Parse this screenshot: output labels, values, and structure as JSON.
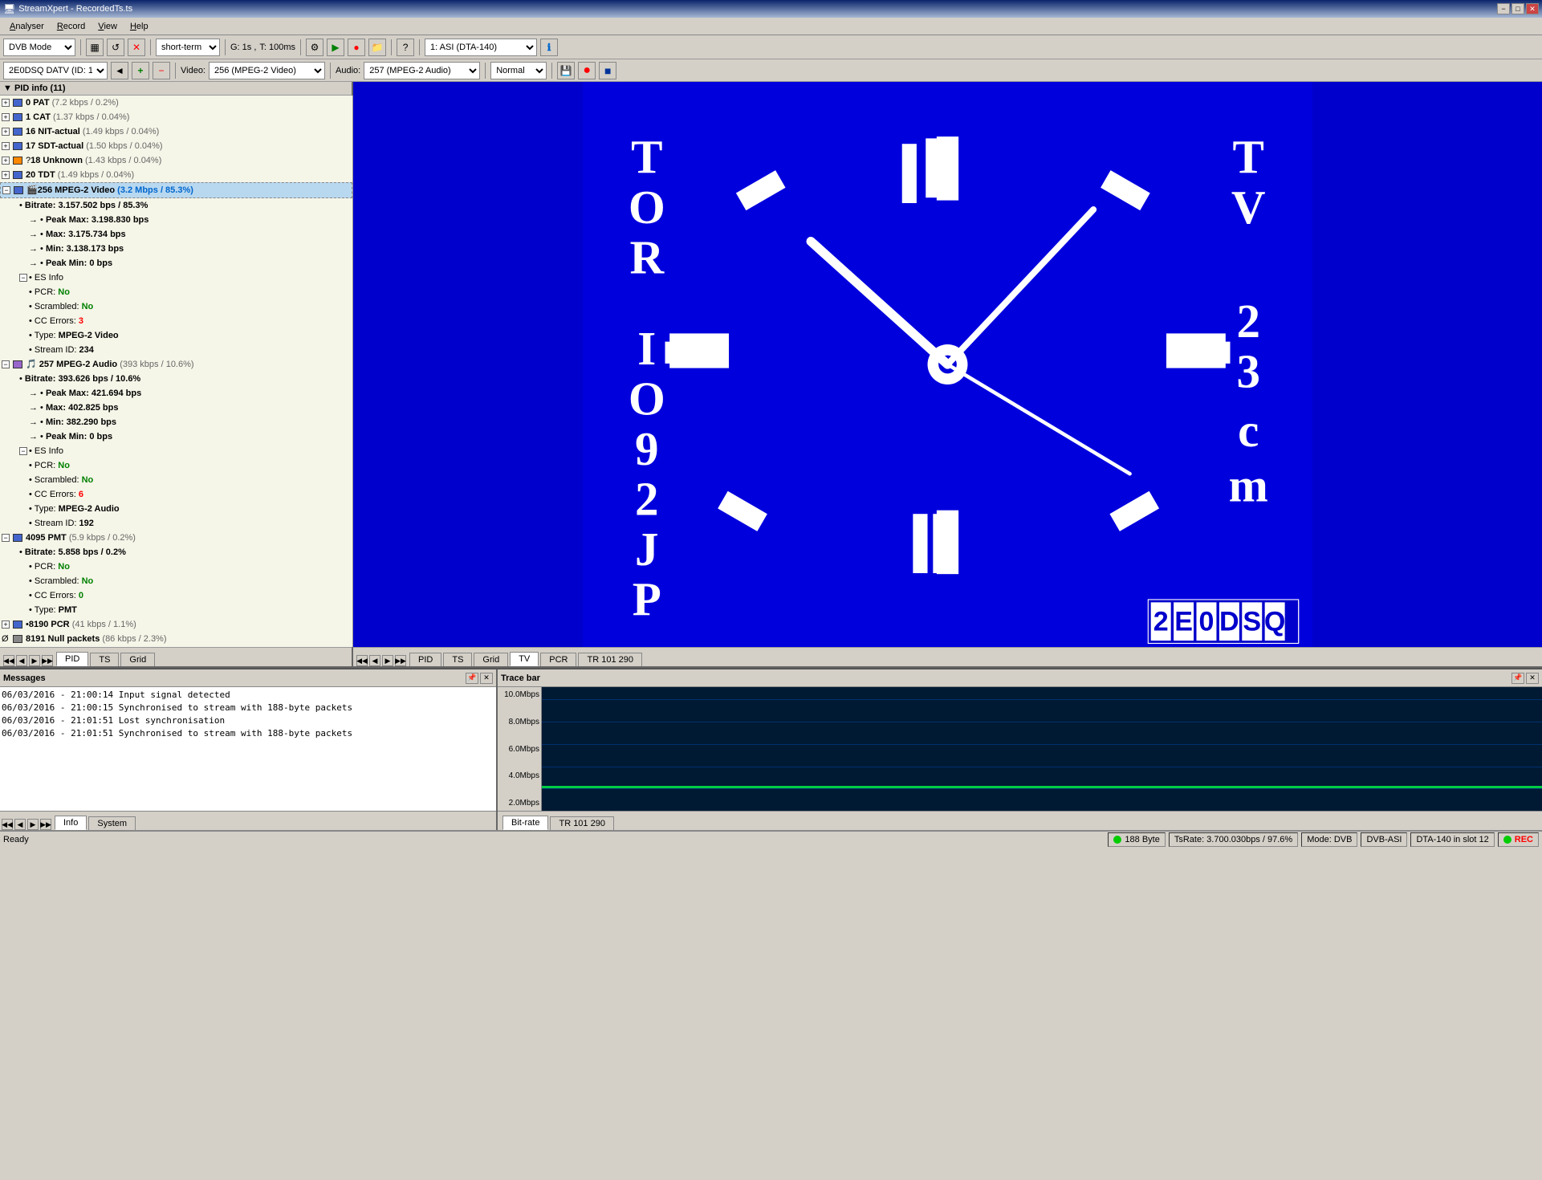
{
  "titlebar": {
    "title": "StreamXpert - RecordedTs.ts",
    "icon": "🖥️",
    "min_btn": "−",
    "max_btn": "□",
    "close_btn": "✕"
  },
  "menubar": {
    "items": [
      {
        "label": "Analyser",
        "key": "A"
      },
      {
        "label": "Record",
        "key": "R"
      },
      {
        "label": "View",
        "key": "V"
      },
      {
        "label": "Help",
        "key": "H"
      }
    ]
  },
  "toolbar1": {
    "mode_label": "DVB Mode",
    "mode_options": [
      "DVB Mode"
    ],
    "grid_icon": "▦",
    "refresh_icon": "↺",
    "close_icon": "✕",
    "timebase_label": "short-term",
    "g_label": "G: 1s",
    "t_label": "T: 100ms",
    "play_icon": "▶",
    "stop_icon": "■",
    "folder_icon": "📁",
    "help_icon": "?",
    "source_label": "1: ASI (DTA-140)",
    "info_icon": "ℹ"
  },
  "toolbar2": {
    "service_label": "2E0DSQ DATV (ID: 1)",
    "add_icon": "+",
    "remove_icon": "−",
    "video_label": "Video:",
    "video_value": "256 (MPEG-2 Video)",
    "audio_label": "Audio:",
    "audio_value": "257 (MPEG-2 Audio)",
    "normal_label": "Normal",
    "save_icon": "💾",
    "record_icon": "●",
    "stop_icon": "■"
  },
  "pid_tree": {
    "header": "PID info  (11)",
    "items": [
      {
        "indent": 0,
        "expand": true,
        "icon": "folder",
        "pid": "0",
        "name": "PAT",
        "bitrate": "(7.2 kbps / 0.2%)",
        "color": "#4040ff"
      },
      {
        "indent": 0,
        "expand": true,
        "icon": "folder",
        "pid": "1",
        "name": "CAT",
        "bitrate": "(1.37 kbps / 0.04%)",
        "color": "#4040ff"
      },
      {
        "indent": 0,
        "expand": true,
        "icon": "folder",
        "pid": "16",
        "name": "NIT-actual",
        "bitrate": "(1.49 kbps / 0.04%)",
        "color": "#4040ff"
      },
      {
        "indent": 0,
        "expand": true,
        "icon": "folder",
        "pid": "17",
        "name": "SDT-actual",
        "bitrate": "(1.50 kbps / 0.04%)",
        "color": "#4040ff"
      },
      {
        "indent": 0,
        "expand": true,
        "icon": "question",
        "pid": "18",
        "name": "Unknown",
        "bitrate": "(1.43 kbps / 0.04%)",
        "color": "#ff8800"
      },
      {
        "indent": 0,
        "expand": true,
        "icon": "folder",
        "pid": "20",
        "name": "TDT",
        "bitrate": "(1.49 kbps / 0.04%)",
        "color": "#4040ff"
      },
      {
        "indent": 0,
        "expand": true,
        "icon": "video",
        "pid": "256",
        "name": "MPEG-2 Video",
        "bitrate": "(3.2 Mbps / 85.3%)",
        "color": "#4040ff",
        "selected": true
      },
      {
        "indent": 1,
        "type": "bitrate",
        "label": "Bitrate:",
        "value": "3.157.502 bps / 85.3%",
        "bold": true
      },
      {
        "indent": 2,
        "type": "stat",
        "label": "Peak Max:",
        "value": "3.198.830 bps",
        "bold": true
      },
      {
        "indent": 2,
        "type": "stat",
        "label": "Max:",
        "value": "3.175.734 bps",
        "bold": true
      },
      {
        "indent": 2,
        "type": "stat",
        "label": "Min:",
        "value": "3.138.173 bps",
        "bold": true
      },
      {
        "indent": 2,
        "type": "stat",
        "label": "Peak Min:",
        "value": "0 bps",
        "bold": true
      },
      {
        "indent": 1,
        "type": "esinfo",
        "label": "ES Info"
      },
      {
        "indent": 2,
        "type": "prop",
        "label": "PCR:",
        "value": "No",
        "value_color": "green"
      },
      {
        "indent": 2,
        "type": "prop",
        "label": "Scrambled:",
        "value": "No",
        "value_color": "green"
      },
      {
        "indent": 2,
        "type": "prop",
        "label": "CC Errors:",
        "value": "3",
        "value_color": "red"
      },
      {
        "indent": 2,
        "type": "prop",
        "label": "Type:",
        "value": "MPEG-2 Video",
        "value_color": "black"
      },
      {
        "indent": 2,
        "type": "prop",
        "label": "Stream ID:",
        "value": "234",
        "value_color": "black"
      },
      {
        "indent": 0,
        "expand": true,
        "icon": "audio",
        "pid": "257",
        "name": "MPEG-2 Audio",
        "bitrate": "(393 kbps / 10.6%)",
        "color": "#aa44ff"
      },
      {
        "indent": 1,
        "type": "bitrate",
        "label": "Bitrate:",
        "value": "393.626 bps / 10.6%",
        "bold": true
      },
      {
        "indent": 2,
        "type": "stat",
        "label": "Peak Max:",
        "value": "421.694 bps",
        "bold": true
      },
      {
        "indent": 2,
        "type": "stat",
        "label": "Max:",
        "value": "402.825 bps",
        "bold": true
      },
      {
        "indent": 2,
        "type": "stat",
        "label": "Min:",
        "value": "382.290 bps",
        "bold": true
      },
      {
        "indent": 2,
        "type": "stat",
        "label": "Peak Min:",
        "value": "0 bps",
        "bold": true
      },
      {
        "indent": 1,
        "type": "esinfo",
        "label": "ES Info"
      },
      {
        "indent": 2,
        "type": "prop",
        "label": "PCR:",
        "value": "No",
        "value_color": "green"
      },
      {
        "indent": 2,
        "type": "prop",
        "label": "Scrambled:",
        "value": "No",
        "value_color": "green"
      },
      {
        "indent": 2,
        "type": "prop",
        "label": "CC Errors:",
        "value": "6",
        "value_color": "red"
      },
      {
        "indent": 2,
        "type": "prop",
        "label": "Type:",
        "value": "MPEG-2 Audio",
        "value_color": "black"
      },
      {
        "indent": 2,
        "type": "prop",
        "label": "Stream ID:",
        "value": "192",
        "value_color": "black"
      },
      {
        "indent": 0,
        "expand": true,
        "icon": "folder",
        "pid": "4095",
        "name": "PMT",
        "bitrate": "(5.9 kbps / 0.2%)",
        "color": "#4040ff"
      },
      {
        "indent": 1,
        "type": "bitrate",
        "label": "Bitrate:",
        "value": "5.858 bps / 0.2%",
        "bold": true
      },
      {
        "indent": 2,
        "type": "prop",
        "label": "PCR:",
        "value": "No",
        "value_color": "green"
      },
      {
        "indent": 2,
        "type": "prop",
        "label": "Scrambled:",
        "value": "No",
        "value_color": "green"
      },
      {
        "indent": 2,
        "type": "prop",
        "label": "CC Errors:",
        "value": "0",
        "value_color": "green"
      },
      {
        "indent": 2,
        "type": "prop",
        "label": "Type:",
        "value": "PMT",
        "value_color": "black"
      },
      {
        "indent": 0,
        "expand": true,
        "icon": "clock",
        "pid": "8190",
        "name": "PCR",
        "bitrate": "(41 kbps / 1.1%)",
        "color": "#4040ff"
      },
      {
        "indent": 0,
        "expand": false,
        "icon": "null",
        "pid": "8191",
        "name": "Null packets",
        "bitrate": "(86 kbps / 2.3%)",
        "color": "#888888"
      }
    ]
  },
  "left_tabs": {
    "nav": [
      "◀◀",
      "◀",
      "▶",
      "▶▶"
    ],
    "tabs": [
      "PID",
      "TS",
      "Grid"
    ]
  },
  "right_tabs": {
    "nav": [
      "◀◀",
      "◀",
      "▶",
      "▶▶"
    ],
    "tabs": [
      "PID",
      "TS",
      "Grid",
      "TV",
      "PCR",
      "TR 101 290"
    ]
  },
  "messages": {
    "title": "Messages",
    "dock_icons": [
      "📌",
      "✕"
    ],
    "lines": [
      "06/03/2016 - 21:00:14 Input signal detected",
      "06/03/2016 - 21:00:15 Synchronised to stream with 188-byte packets",
      "06/03/2016 - 21:01:51 Lost synchronisation",
      "06/03/2016 - 21:01:51 Synchronised to stream with 188-byte packets"
    ]
  },
  "trace": {
    "title": "Trace bar",
    "dock_icons": [
      "📌",
      "✕"
    ],
    "y_labels": [
      "10.0Mbps",
      "8.0Mbps",
      "6.0Mbps",
      "4.0Mbps",
      "2.0Mbps"
    ],
    "tabs": [
      "Bit-rate",
      "TR 101 290"
    ]
  },
  "bottom_left_tabs": {
    "nav": [
      "◀◀",
      "◀",
      "▶",
      "▶▶"
    ],
    "tabs": [
      "Info",
      "System"
    ],
    "active": "Info"
  },
  "statusbar": {
    "ready": "Ready",
    "byte_size": "188 Byte",
    "ts_rate": "TsRate: 3.700.030bps / 97.6%",
    "mode": "Mode: DVB",
    "dbs_asi": "DVB-ASI",
    "slot": "DTA-140 in slot 12",
    "rec": "REC"
  },
  "clock": {
    "text_left": [
      "T",
      "O",
      "R",
      "",
      "I",
      "O",
      "9",
      "2",
      "J",
      "P"
    ],
    "text_right": [
      "T",
      "V",
      "",
      "2",
      "3",
      "c",
      "m"
    ],
    "callsign": "2E0DSQ"
  }
}
